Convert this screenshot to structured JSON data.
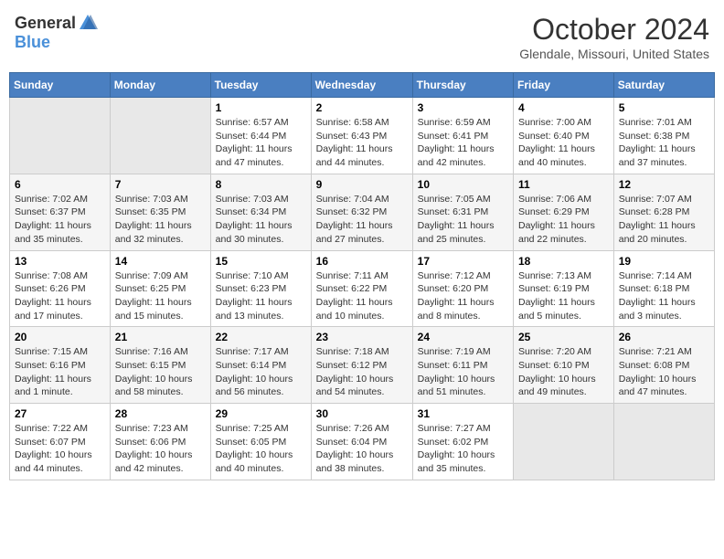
{
  "header": {
    "logo_general": "General",
    "logo_blue": "Blue",
    "title": "October 2024",
    "subtitle": "Glendale, Missouri, United States"
  },
  "weekdays": [
    "Sunday",
    "Monday",
    "Tuesday",
    "Wednesday",
    "Thursday",
    "Friday",
    "Saturday"
  ],
  "weeks": [
    [
      {
        "day": "",
        "info": ""
      },
      {
        "day": "",
        "info": ""
      },
      {
        "day": "1",
        "info": "Sunrise: 6:57 AM\nSunset: 6:44 PM\nDaylight: 11 hours and 47 minutes."
      },
      {
        "day": "2",
        "info": "Sunrise: 6:58 AM\nSunset: 6:43 PM\nDaylight: 11 hours and 44 minutes."
      },
      {
        "day": "3",
        "info": "Sunrise: 6:59 AM\nSunset: 6:41 PM\nDaylight: 11 hours and 42 minutes."
      },
      {
        "day": "4",
        "info": "Sunrise: 7:00 AM\nSunset: 6:40 PM\nDaylight: 11 hours and 40 minutes."
      },
      {
        "day": "5",
        "info": "Sunrise: 7:01 AM\nSunset: 6:38 PM\nDaylight: 11 hours and 37 minutes."
      }
    ],
    [
      {
        "day": "6",
        "info": "Sunrise: 7:02 AM\nSunset: 6:37 PM\nDaylight: 11 hours and 35 minutes."
      },
      {
        "day": "7",
        "info": "Sunrise: 7:03 AM\nSunset: 6:35 PM\nDaylight: 11 hours and 32 minutes."
      },
      {
        "day": "8",
        "info": "Sunrise: 7:03 AM\nSunset: 6:34 PM\nDaylight: 11 hours and 30 minutes."
      },
      {
        "day": "9",
        "info": "Sunrise: 7:04 AM\nSunset: 6:32 PM\nDaylight: 11 hours and 27 minutes."
      },
      {
        "day": "10",
        "info": "Sunrise: 7:05 AM\nSunset: 6:31 PM\nDaylight: 11 hours and 25 minutes."
      },
      {
        "day": "11",
        "info": "Sunrise: 7:06 AM\nSunset: 6:29 PM\nDaylight: 11 hours and 22 minutes."
      },
      {
        "day": "12",
        "info": "Sunrise: 7:07 AM\nSunset: 6:28 PM\nDaylight: 11 hours and 20 minutes."
      }
    ],
    [
      {
        "day": "13",
        "info": "Sunrise: 7:08 AM\nSunset: 6:26 PM\nDaylight: 11 hours and 17 minutes."
      },
      {
        "day": "14",
        "info": "Sunrise: 7:09 AM\nSunset: 6:25 PM\nDaylight: 11 hours and 15 minutes."
      },
      {
        "day": "15",
        "info": "Sunrise: 7:10 AM\nSunset: 6:23 PM\nDaylight: 11 hours and 13 minutes."
      },
      {
        "day": "16",
        "info": "Sunrise: 7:11 AM\nSunset: 6:22 PM\nDaylight: 11 hours and 10 minutes."
      },
      {
        "day": "17",
        "info": "Sunrise: 7:12 AM\nSunset: 6:20 PM\nDaylight: 11 hours and 8 minutes."
      },
      {
        "day": "18",
        "info": "Sunrise: 7:13 AM\nSunset: 6:19 PM\nDaylight: 11 hours and 5 minutes."
      },
      {
        "day": "19",
        "info": "Sunrise: 7:14 AM\nSunset: 6:18 PM\nDaylight: 11 hours and 3 minutes."
      }
    ],
    [
      {
        "day": "20",
        "info": "Sunrise: 7:15 AM\nSunset: 6:16 PM\nDaylight: 11 hours and 1 minute."
      },
      {
        "day": "21",
        "info": "Sunrise: 7:16 AM\nSunset: 6:15 PM\nDaylight: 10 hours and 58 minutes."
      },
      {
        "day": "22",
        "info": "Sunrise: 7:17 AM\nSunset: 6:14 PM\nDaylight: 10 hours and 56 minutes."
      },
      {
        "day": "23",
        "info": "Sunrise: 7:18 AM\nSunset: 6:12 PM\nDaylight: 10 hours and 54 minutes."
      },
      {
        "day": "24",
        "info": "Sunrise: 7:19 AM\nSunset: 6:11 PM\nDaylight: 10 hours and 51 minutes."
      },
      {
        "day": "25",
        "info": "Sunrise: 7:20 AM\nSunset: 6:10 PM\nDaylight: 10 hours and 49 minutes."
      },
      {
        "day": "26",
        "info": "Sunrise: 7:21 AM\nSunset: 6:08 PM\nDaylight: 10 hours and 47 minutes."
      }
    ],
    [
      {
        "day": "27",
        "info": "Sunrise: 7:22 AM\nSunset: 6:07 PM\nDaylight: 10 hours and 44 minutes."
      },
      {
        "day": "28",
        "info": "Sunrise: 7:23 AM\nSunset: 6:06 PM\nDaylight: 10 hours and 42 minutes."
      },
      {
        "day": "29",
        "info": "Sunrise: 7:25 AM\nSunset: 6:05 PM\nDaylight: 10 hours and 40 minutes."
      },
      {
        "day": "30",
        "info": "Sunrise: 7:26 AM\nSunset: 6:04 PM\nDaylight: 10 hours and 38 minutes."
      },
      {
        "day": "31",
        "info": "Sunrise: 7:27 AM\nSunset: 6:02 PM\nDaylight: 10 hours and 35 minutes."
      },
      {
        "day": "",
        "info": ""
      },
      {
        "day": "",
        "info": ""
      }
    ]
  ]
}
